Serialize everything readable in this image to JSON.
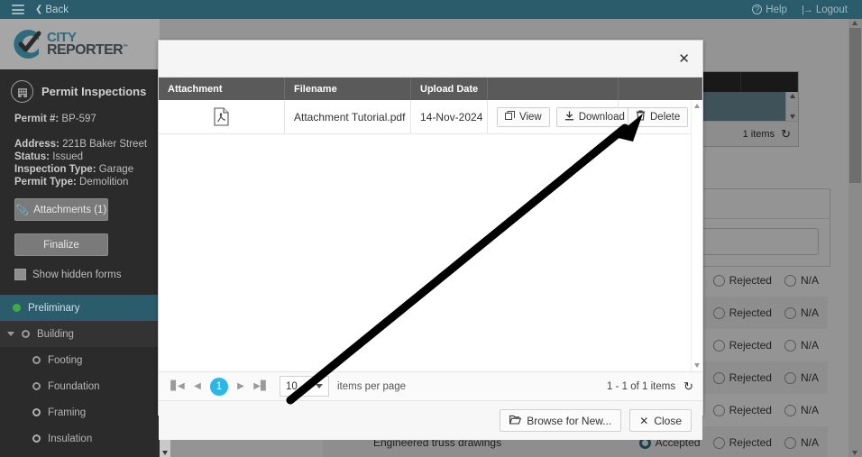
{
  "topbar": {
    "menu_icon": "hamburger-icon",
    "back_label": "Back",
    "help_label": "Help",
    "logout_label": "Logout"
  },
  "brand": {
    "line1": "CITY",
    "line2": "REPORTER",
    "tm": "™",
    "accent": "#2e6b7d"
  },
  "sidebar": {
    "title": "Permit Inspections",
    "permit_label": "Permit #:",
    "permit_value": "BP-597",
    "address_label": "Address:",
    "address_value": "221B Baker Street",
    "status_label": "Status:",
    "status_value": "Issued",
    "inspection_label": "Inspection Type:",
    "inspection_value": "Garage",
    "permit_type_label": "Permit Type:",
    "permit_type_value": "Demolition",
    "attachments_button": "Attachments (1)",
    "finalize_button": "Finalize",
    "show_hidden_label": "Show hidden forms",
    "nav": [
      {
        "label": "Preliminary",
        "icon": "green-dot-icon",
        "level": 0,
        "active": true
      },
      {
        "label": "Building",
        "icon": "ring-icon",
        "level": 1,
        "active": false
      },
      {
        "label": "Footing",
        "icon": "ring-icon",
        "level": 2,
        "active": false
      },
      {
        "label": "Foundation",
        "icon": "ring-icon",
        "level": 2,
        "active": false
      },
      {
        "label": "Framing",
        "icon": "ring-icon",
        "level": 2,
        "active": false
      },
      {
        "label": "Insulation",
        "icon": "ring-icon",
        "level": 2,
        "active": false
      }
    ]
  },
  "background": {
    "grid_footer_count": "1 items",
    "refresh_icon": "refresh-icon",
    "row_label": "Engineered truss drawings",
    "radio_options": [
      "Accepted",
      "Rejected",
      "N/A"
    ],
    "rows": [
      {
        "label": "",
        "selected": ""
      },
      {
        "label": "",
        "selected": ""
      },
      {
        "label": "",
        "selected": ""
      },
      {
        "label": "",
        "selected": ""
      },
      {
        "label": "",
        "selected": ""
      },
      {
        "label": "Engineered truss drawings",
        "selected": "Accepted"
      }
    ]
  },
  "modal": {
    "close_icon": "close-icon",
    "columns": [
      "Attachment",
      "Filename",
      "Upload Date",
      "",
      ""
    ],
    "rows": [
      {
        "file_icon": "pdf-file-icon",
        "filename": "Attachment Tutorial.pdf",
        "upload_date": "14-Nov-2024",
        "view_label": "View",
        "download_label": "Download",
        "delete_label": "Delete"
      }
    ],
    "pager": {
      "first_icon": "first-page-icon",
      "prev_icon": "prev-page-icon",
      "page_number": "1",
      "next_icon": "next-page-icon",
      "last_icon": "last-page-icon",
      "page_size": "10",
      "items_per_page_label": "items per page",
      "range_label": "1 - 1 of 1 items",
      "refresh_icon": "refresh-icon",
      "accent": "#29b6e8"
    },
    "footer": {
      "browse_label": "Browse for New...",
      "close_label": "Close"
    }
  },
  "annotation": {
    "arrow": "black-arrow-pointing-to-delete-button"
  }
}
